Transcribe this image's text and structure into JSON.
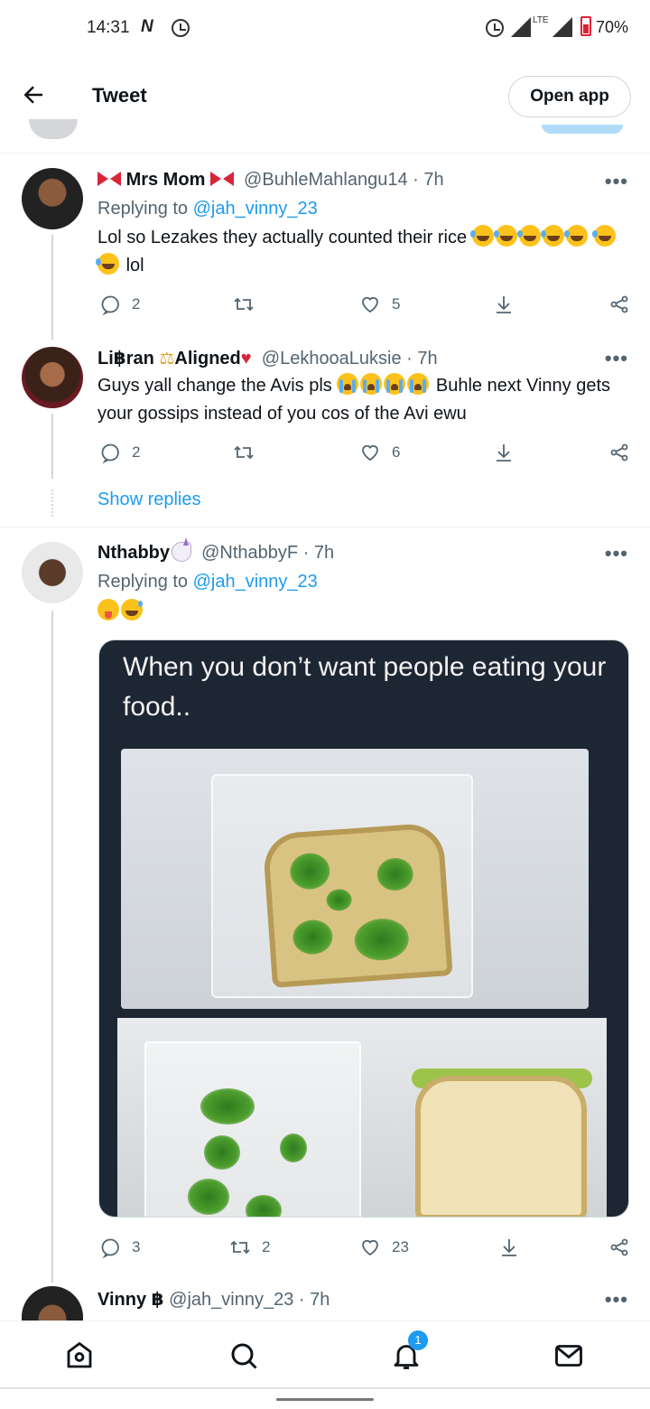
{
  "status_bar": {
    "time": "14:31",
    "notification_icon": "N",
    "lte": "LTE",
    "battery": "70%"
  },
  "header": {
    "title": "Tweet",
    "open_app": "Open app"
  },
  "tweets": [
    {
      "name": "Mrs Mom",
      "handle": "@BuhleMahlangu14",
      "time": "7h",
      "replying_label": "Replying to",
      "replying_handle": "@jah_vinny_23",
      "text_part1": "Lol so Lezakes they actually counted their rice",
      "text_part2": "lol",
      "replies": "2",
      "retweets": "",
      "likes": "5"
    },
    {
      "name_part1": "Li฿ran",
      "name_part2": "Aligned",
      "handle": "@LekhooaLuksie",
      "time": "7h",
      "text_part1": "Guys yall change the Avis pls",
      "text_part2": "Buhle next Vinny gets your gossips instead of you cos of the Avi ewu",
      "replies": "2",
      "retweets": "",
      "likes": "6",
      "show_replies": "Show replies"
    },
    {
      "name": "Nthabby",
      "handle": "@NthabbyF",
      "time": "7h",
      "replying_label": "Replying to",
      "replying_handle": "@jah_vinny_23",
      "media_caption": "When you don’t want people eating your food..",
      "replies": "3",
      "retweets": "2",
      "likes": "23"
    },
    {
      "name": "Vinny ฿",
      "handle": "@jah_vinny_23",
      "time": "7h"
    }
  ],
  "bottom_nav": {
    "notifications_badge": "1"
  },
  "colors": {
    "accent": "#1d9bf0",
    "text": "#0f1419",
    "muted": "#536471",
    "border": "#cfd9de"
  }
}
